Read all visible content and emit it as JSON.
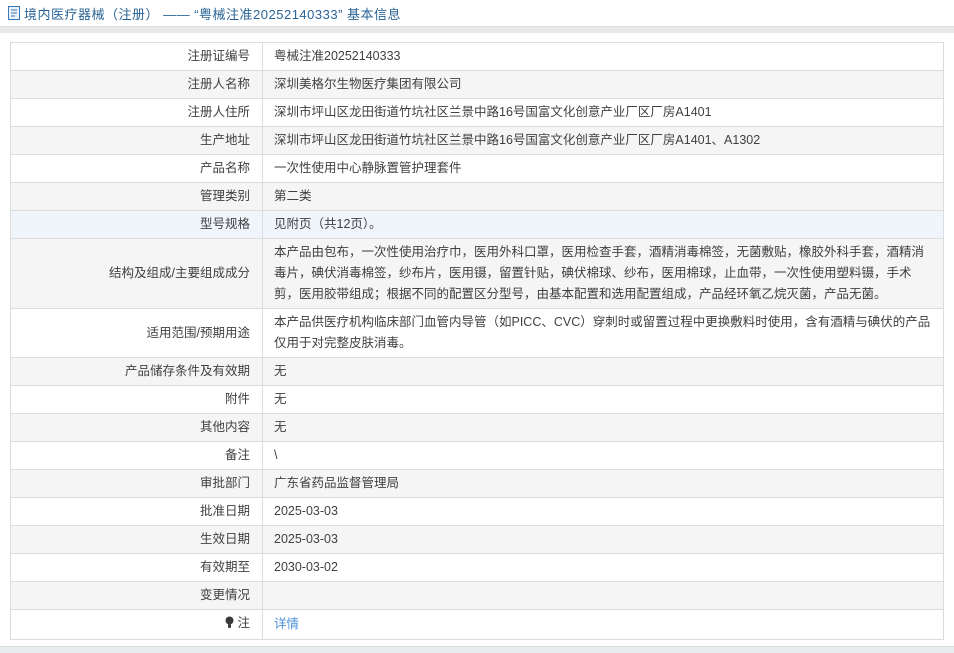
{
  "header": {
    "icon": "document-icon",
    "title": "境内医疗器械（注册） —— “粤械注准20252140333” 基本信息"
  },
  "colors": {
    "title_blue": "#2a6496",
    "link_blue": "#4a90d9",
    "stripe_gray": "#f5f5f6",
    "highlight_row": "#f0f4fb",
    "border_gray": "#dcdcdc"
  },
  "table": {
    "rows": [
      {
        "label": "注册证编号",
        "value": "粤械注准20252140333"
      },
      {
        "label": "注册人名称",
        "value": "深圳美格尔生物医疗集团有限公司"
      },
      {
        "label": "注册人住所",
        "value": "深圳市坪山区龙田街道竹坑社区兰景中路16号国富文化创意产业厂区厂房A1401"
      },
      {
        "label": "生产地址",
        "value": "深圳市坪山区龙田街道竹坑社区兰景中路16号国富文化创意产业厂区厂房A1401、A1302"
      },
      {
        "label": "产品名称",
        "value": "一次性使用中心静脉置管护理套件"
      },
      {
        "label": "管理类别",
        "value": "第二类"
      },
      {
        "label": "型号规格",
        "value": "见附页（共12页）。",
        "highlight": true
      },
      {
        "label": "结构及组成/主要组成成分",
        "value": "本产品由包布，一次性使用治疗巾，医用外科口罩，医用检查手套，酒精消毒棉签，无菌敷贴，橡胶外科手套，酒精消毒片，碘伏消毒棉签，纱布片，医用镊，留置针贴，碘伏棉球、纱布，医用棉球，止血带，一次性使用塑料镊，手术剪，医用胶带组成；根据不同的配置区分型号，由基本配置和选用配置组成，产品经环氧乙烷灭菌，产品无菌。"
      },
      {
        "label": "适用范围/预期用途",
        "value": "本产品供医疗机构临床部门血管内导管（如PICC、CVC）穿刺时或留置过程中更换敷料时使用，含有酒精与碘伏的产品仅用于对完整皮肤消毒。"
      },
      {
        "label": "产品储存条件及有效期",
        "value": "无"
      },
      {
        "label": "附件",
        "value": "无"
      },
      {
        "label": "其他内容",
        "value": "无"
      },
      {
        "label": "备注",
        "value": "\\"
      },
      {
        "label": "审批部门",
        "value": "广东省药品监督管理局"
      },
      {
        "label": "批准日期",
        "value": "2025-03-03"
      },
      {
        "label": "生效日期",
        "value": "2025-03-03"
      },
      {
        "label": "有效期至",
        "value": "2030-03-02"
      },
      {
        "label": "变更情况",
        "value": ""
      },
      {
        "label": "注",
        "value": "详情",
        "value_is_link": true,
        "label_icon": "bulb-icon"
      }
    ]
  }
}
